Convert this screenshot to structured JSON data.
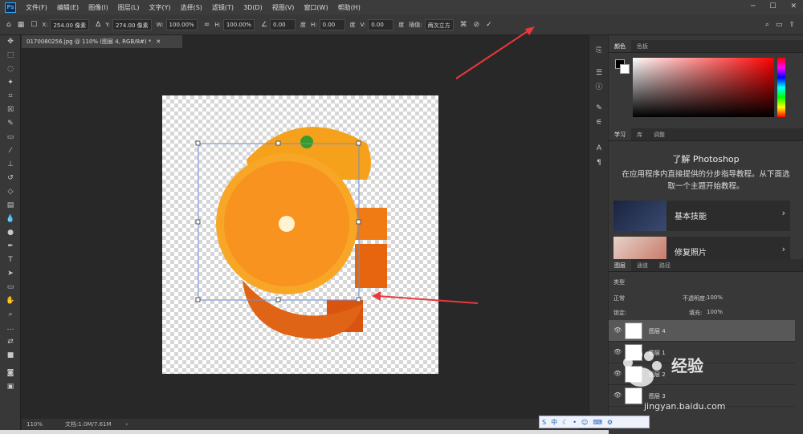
{
  "menubar": {
    "items": [
      "文件(F)",
      "编辑(E)",
      "图像(I)",
      "图层(L)",
      "文字(Y)",
      "选择(S)",
      "滤镜(T)",
      "3D(D)",
      "视图(V)",
      "窗口(W)",
      "帮助(H)"
    ]
  },
  "options": {
    "x_label": "X:",
    "x_value": "254.00 像素",
    "y_label": "Y:",
    "y_value": "274.00 像素",
    "w_label": "W:",
    "w_value": "100.00%",
    "h_label": "H:",
    "h_value": "100.00%",
    "angle_value": "0.00",
    "angle_unit": "度",
    "hskew_label": "H:",
    "hskew_value": "0.00",
    "hskew_unit": "度",
    "vskew_label": "V:",
    "vskew_value": "0.00",
    "vskew_unit": "度",
    "interp_label": "插值:",
    "interp_value": "两次立方"
  },
  "document": {
    "tab_title": "0170080256.jpg @ 110% (图层 4, RGB/8#) *",
    "zoom": "110%",
    "doc_info": "文档:1.0M/7.61M"
  },
  "color_panel": {
    "tabs": [
      "颜色",
      "色板"
    ],
    "accent": "#31a8ff"
  },
  "learn_panel": {
    "tabs": [
      "学习",
      "库",
      "调整"
    ],
    "title": "了解 Photoshop",
    "description": "在应用程序内直接提供的分步指导教程。从下面选取一个主题开始教程。",
    "cards": [
      {
        "label": "基本技能"
      },
      {
        "label": "修复照片"
      }
    ]
  },
  "layers_panel": {
    "tabs": [
      "图层",
      "通道",
      "路径"
    ],
    "kind_filter": "类型",
    "blend_mode": "正常",
    "opacity_label": "不透明度:",
    "opacity_value": "100%",
    "lock_label": "锁定:",
    "fill_label": "填充:",
    "fill_value": "100%",
    "layers": [
      {
        "name": "图层 4",
        "selected": true
      },
      {
        "name": "图层 1",
        "selected": false
      },
      {
        "name": "图层 2",
        "selected": false
      },
      {
        "name": "图层 3",
        "selected": false
      }
    ]
  },
  "ime": {
    "label": "中"
  },
  "watermark": {
    "text": "经验",
    "url": "jingyan.baidu.com"
  }
}
